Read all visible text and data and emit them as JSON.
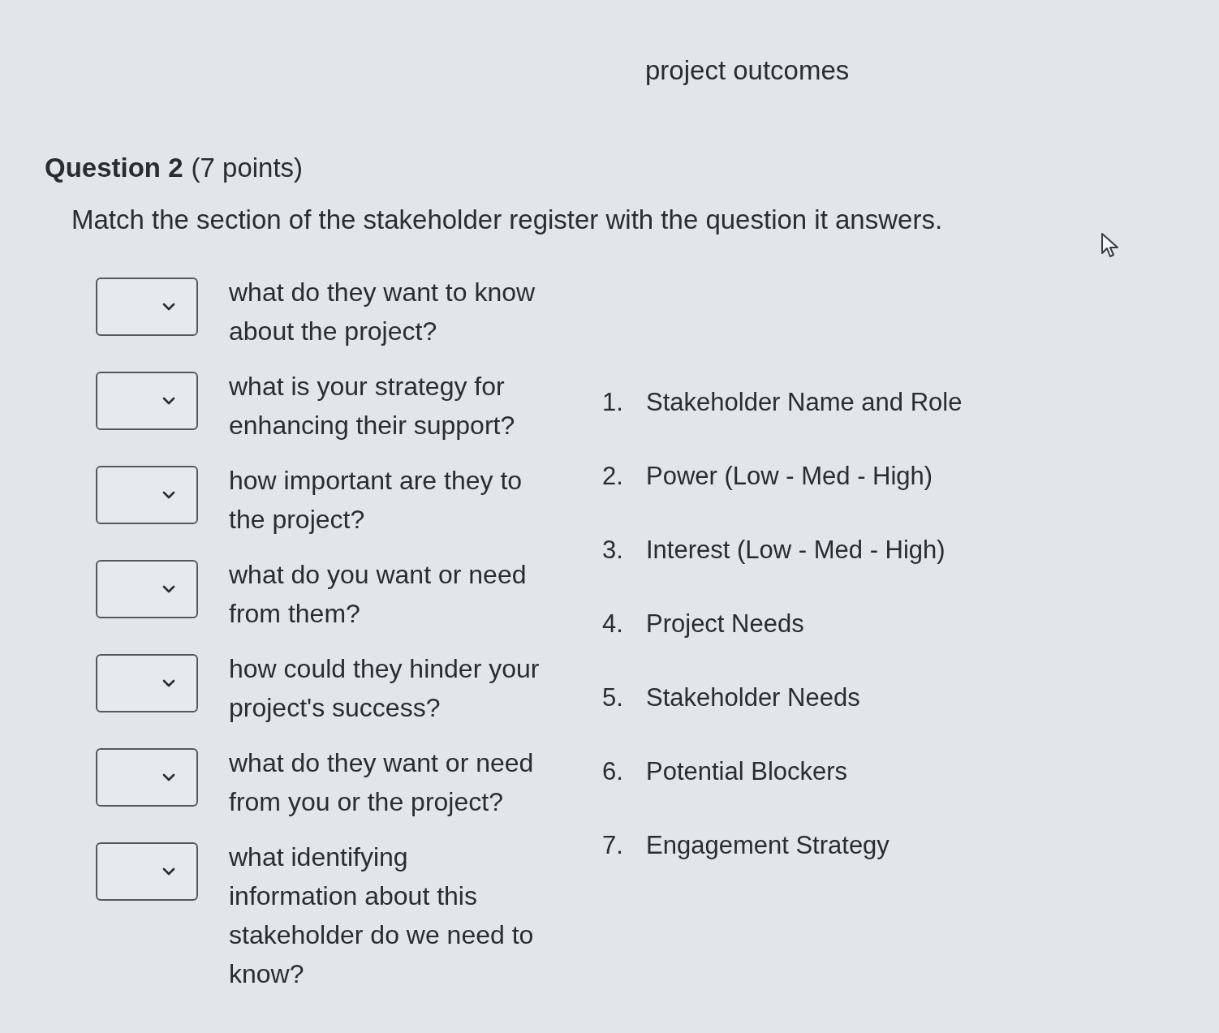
{
  "page_title": "project outcomes",
  "question": {
    "title": "Question 2",
    "points": "(7 points)",
    "instruction": "Match the section of the stakeholder register with the question it answers."
  },
  "prompts": [
    {
      "text": "what do they want to know about the project?"
    },
    {
      "text": "what is your strategy for enhancing their support?"
    },
    {
      "text": "how important are they to the project?"
    },
    {
      "text": "what do you want or need from them?"
    },
    {
      "text": "how could they hinder your project's success?"
    },
    {
      "text": "what do they want or need from you or the project?"
    },
    {
      "text": "what identifying information about this stakeholder do we need to know?"
    }
  ],
  "options": [
    {
      "number": "1.",
      "label": "Stakeholder Name and Role"
    },
    {
      "number": "2.",
      "label": "Power (Low - Med - High)"
    },
    {
      "number": "3.",
      "label": "Interest (Low - Med - High)"
    },
    {
      "number": "4.",
      "label": "Project Needs"
    },
    {
      "number": "5.",
      "label": "Stakeholder Needs"
    },
    {
      "number": "6.",
      "label": "Potential Blockers"
    },
    {
      "number": "7.",
      "label": "Engagement Strategy"
    }
  ]
}
